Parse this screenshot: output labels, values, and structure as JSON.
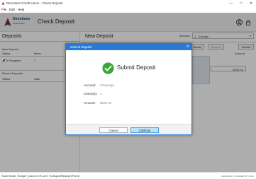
{
  "window": {
    "title": "Directions Credit Union - Check Deposit",
    "minimize_glyph": "—",
    "maximize_glyph": "□",
    "close_glyph": "✕"
  },
  "menu": [
    "File",
    "Edit",
    "Help"
  ],
  "header": {
    "logo_name": "Directions",
    "logo_sub": "Credit Union",
    "title": "Check Deposit"
  },
  "deposits": {
    "title": "Deposits",
    "new_deposit": {
      "label": "New Deposit",
      "columns": [
        "Status",
        "Items"
      ],
      "rows": [
        {
          "status": "In Progress",
          "items": "1"
        }
      ]
    },
    "recent_deposits": {
      "label": "Recent Deposits",
      "columns": [
        "Status",
        "Date"
      ]
    }
  },
  "main": {
    "title": "New Deposit",
    "account_label": "Account:",
    "account_value": "2 - Savings",
    "buttons": {
      "delete": "Delete",
      "rescan": "Rescan",
      "submit": "Submit"
    },
    "amount_header": "Amount",
    "amount_value": "$100.00"
  },
  "dialog": {
    "title": "Submit Deposit",
    "heading": "Submit Deposit",
    "close_glyph": "✕",
    "fields": [
      {
        "label": "Account:",
        "value": "2/Savings"
      },
      {
        "label": "Check(s):",
        "value": "1"
      },
      {
        "label": "Amount:",
        "value": "$100.00"
      }
    ],
    "cancel": "Cancel",
    "continue": "Continue",
    "accent": "#2a7ad5",
    "success_color": "#3aa53a"
  },
  "statusbar": {
    "left": "Scan Mode: Ranger (Canon CR-120: TransportReadyToFeed)",
    "right": "FEDERALLY INSURED BY NCUA"
  }
}
